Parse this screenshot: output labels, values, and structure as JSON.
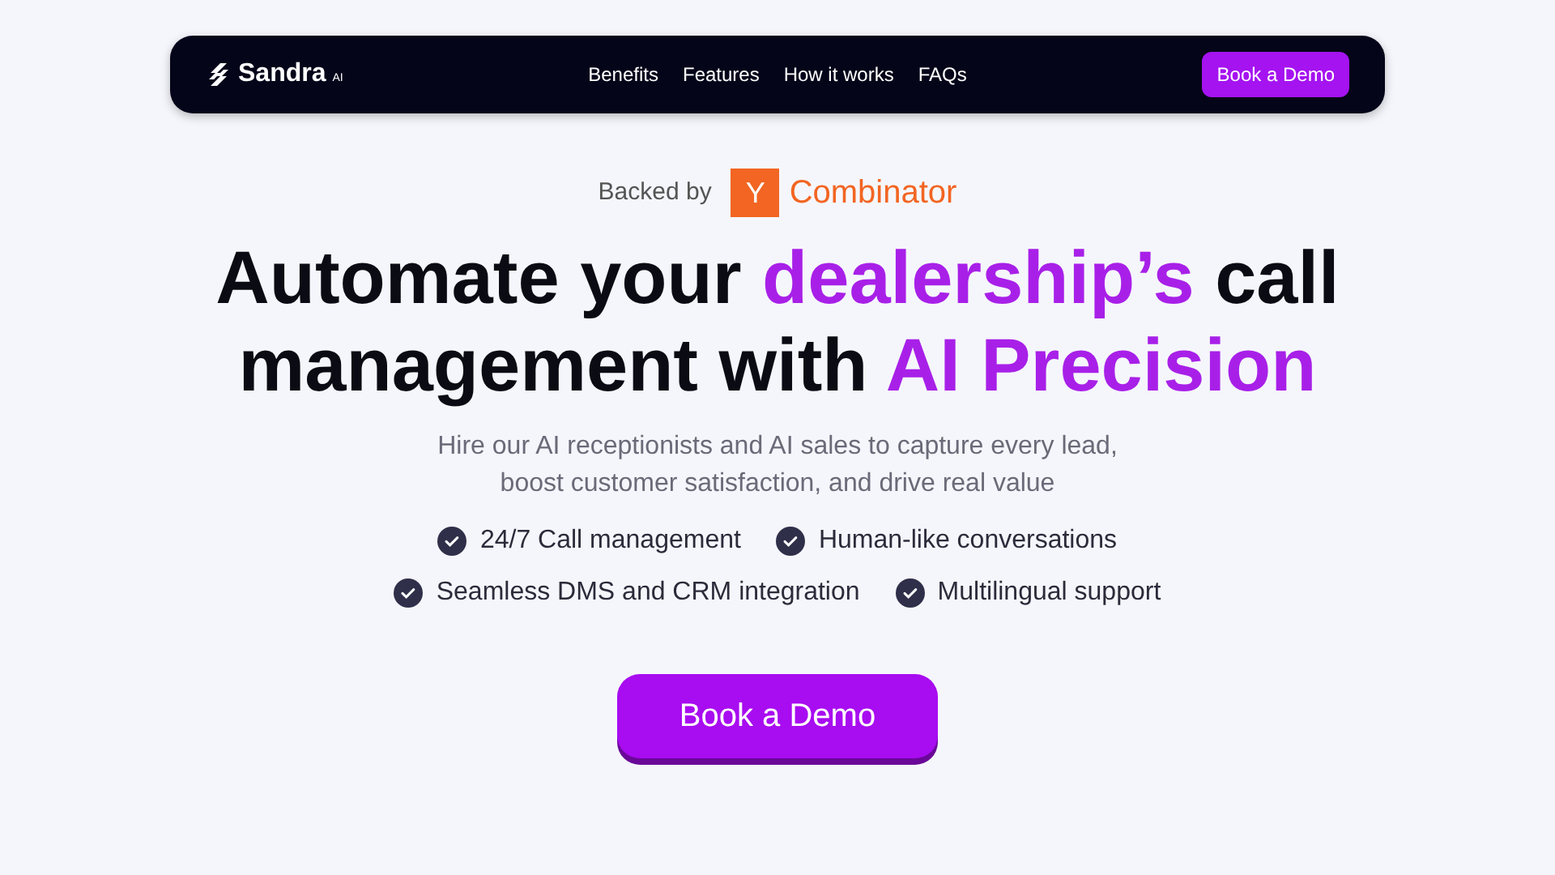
{
  "navbar": {
    "logo": "Sandra",
    "logo_badge": "AI",
    "links": [
      "Benefits",
      "Features",
      "How it works",
      "FAQs"
    ],
    "cta": "Book a Demo"
  },
  "backed": {
    "label": "Backed by",
    "badge_letter": "Y",
    "name": "Combinator"
  },
  "headline": {
    "lines": [
      [
        {
          "text": "Automate your ",
          "highlight": false
        },
        {
          "text": "dealership’s",
          "highlight": true
        },
        {
          "text": " call",
          "highlight": false
        }
      ],
      [
        {
          "text": "management with ",
          "highlight": false
        },
        {
          "text": "AI Precision",
          "highlight": true
        }
      ]
    ]
  },
  "subtitle": [
    "Hire our AI receptionists and AI sales to capture every lead,",
    "boost customer satisfaction, and drive real value"
  ],
  "features": [
    [
      "24/7 Call management",
      "Human-like conversations"
    ],
    [
      "Seamless DMS and CRM integration",
      "Multilingual support"
    ]
  ],
  "cta": "Book a Demo"
}
